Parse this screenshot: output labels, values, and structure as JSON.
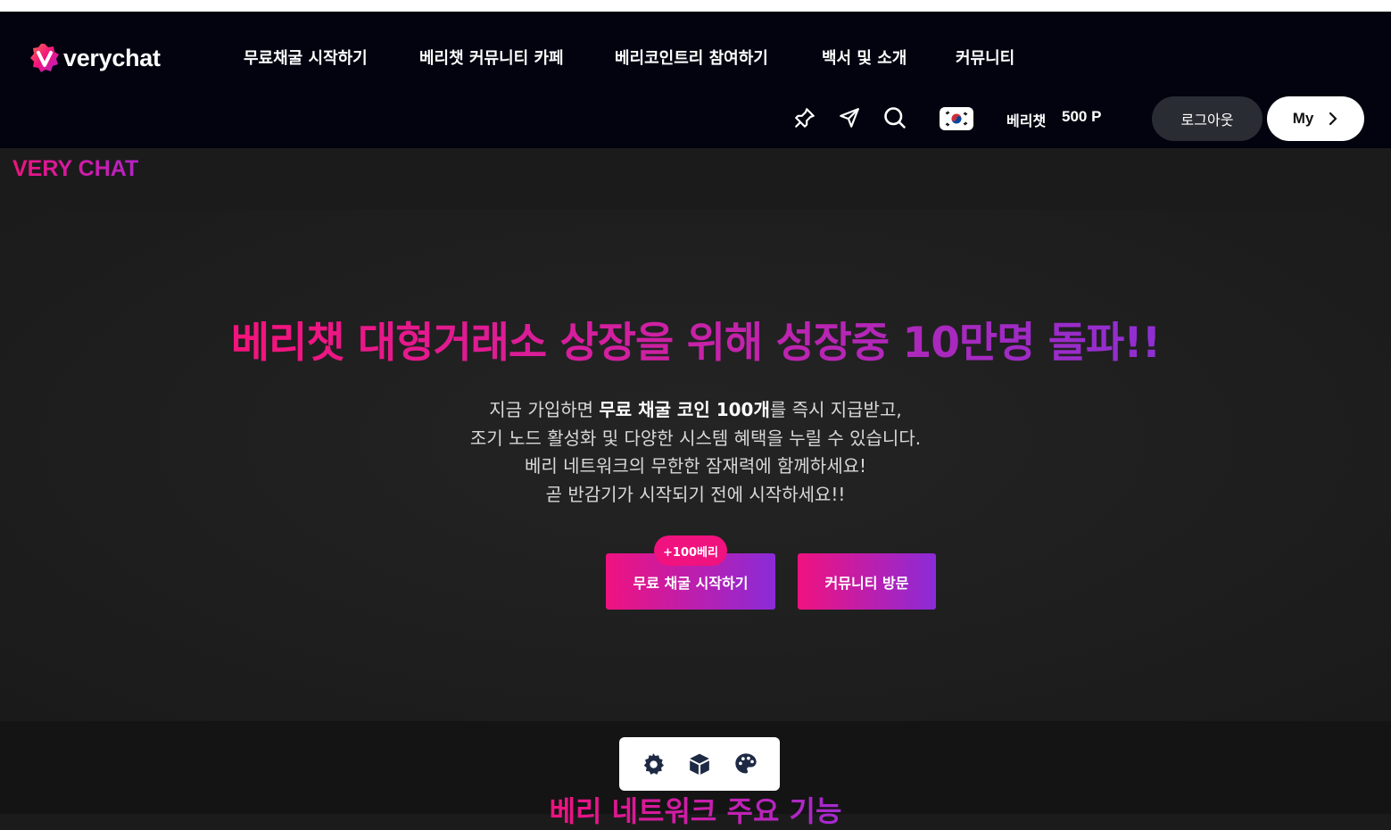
{
  "brand": {
    "logo_text": "verychat",
    "label": "VERY CHAT"
  },
  "nav": {
    "items": [
      {
        "label": "무료채굴 시작하기"
      },
      {
        "label": "베리챗 커뮤니티 카페"
      },
      {
        "label": "베리코인트리 참여하기"
      },
      {
        "label": "백서 및 소개"
      },
      {
        "label": "커뮤니티"
      }
    ]
  },
  "toolbar": {
    "icons": [
      "pin-icon",
      "send-icon",
      "search-icon",
      "korea-flag-icon"
    ],
    "points_label": "베리챗",
    "points_value": "500 P",
    "logout_label": "로그아웃",
    "my_label": "My"
  },
  "hero": {
    "title": "베리챗 대형거래소 상장을 위해 성장중 10만명 돌파!!",
    "line1_pre": "지금 가입하면 ",
    "line1_bold": "무료 채굴 코인 100개",
    "line1_post": "를 즉시 지급받고,",
    "line2": "조기 노드 활성화 및 다양한 시스템 혜택을 누릴 수 있습니다.",
    "line3": "베리 네트워크의 무한한 잠재력에 함께하세요!",
    "line4": "곧 반감기가 시작되기 전에 시작하세요!!",
    "badge": "+100베리",
    "cta_primary": "무료 채굴 시작하기",
    "cta_secondary": "커뮤니티 방문"
  },
  "floating_tools": [
    "settings-icon",
    "cube-icon",
    "palette-icon"
  ],
  "section": {
    "title": "베리 네트워크 주요 기능"
  },
  "colors": {
    "accent_pink": "#f0127f",
    "accent_purple": "#8a2bd8",
    "header_bg": "#02030f"
  }
}
